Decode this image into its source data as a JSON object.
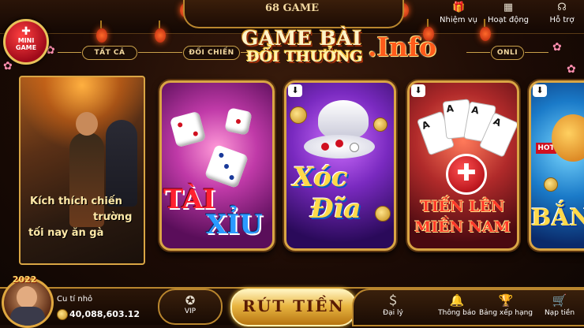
{
  "top_nav": {
    "mission": {
      "label": "Nhiệm vụ",
      "icon": "gift-icon"
    },
    "events": {
      "label": "Hoạt động",
      "icon": "calendar-icon"
    },
    "support": {
      "label": "Hỗ trợ",
      "icon": "headset-icon"
    }
  },
  "mini_game": {
    "label_top": "MINI",
    "label_bottom": "GAME"
  },
  "filters": [
    {
      "label": "TẤT CẢ"
    },
    {
      "label": "ĐỐI CHIẾN"
    },
    {
      "label": "ONLI"
    }
  ],
  "logo": {
    "line1": "GAME BÀI",
    "line2": "ĐỔI THƯỞNG",
    "suffix": ".Info",
    "watermark": "68 GAME"
  },
  "promo_card": {
    "text_line1": "Kích thích chiến",
    "text_line2": "trường",
    "text_line3": "tối nay ăn gà"
  },
  "games": [
    {
      "title_line1": "TÀI",
      "title_line2": "XỈU",
      "has_download": false
    },
    {
      "title_line1": "Xóc",
      "title_line2": "Đĩa",
      "has_download": true
    },
    {
      "title_line1": "TIẾN LÊN",
      "title_line2": "MIỀN NAM",
      "has_download": true,
      "card_rank": "A"
    },
    {
      "title_line1": "BẮN",
      "title_line2": "",
      "badge": "HOT",
      "has_download": true
    }
  ],
  "user": {
    "name": "Cu tí nhỏ",
    "balance": "40,088,603.12",
    "badge": "2022"
  },
  "bottom": {
    "vip_label": "VIP",
    "withdraw_label": "RÚT TIỀN",
    "dock": [
      {
        "label": "Đại lý",
        "icon": "dollar-coin-icon"
      },
      {
        "label": "Thông báo",
        "icon": "bell-icon"
      },
      {
        "label": "Bảng xếp hạng",
        "icon": "trophy-icon"
      },
      {
        "label": "Nạp tiền",
        "icon": "cart-icon"
      }
    ]
  },
  "colors": {
    "gold": "#d9a544",
    "bg": "#1a0c06",
    "accent_red": "#ff5a1a"
  }
}
